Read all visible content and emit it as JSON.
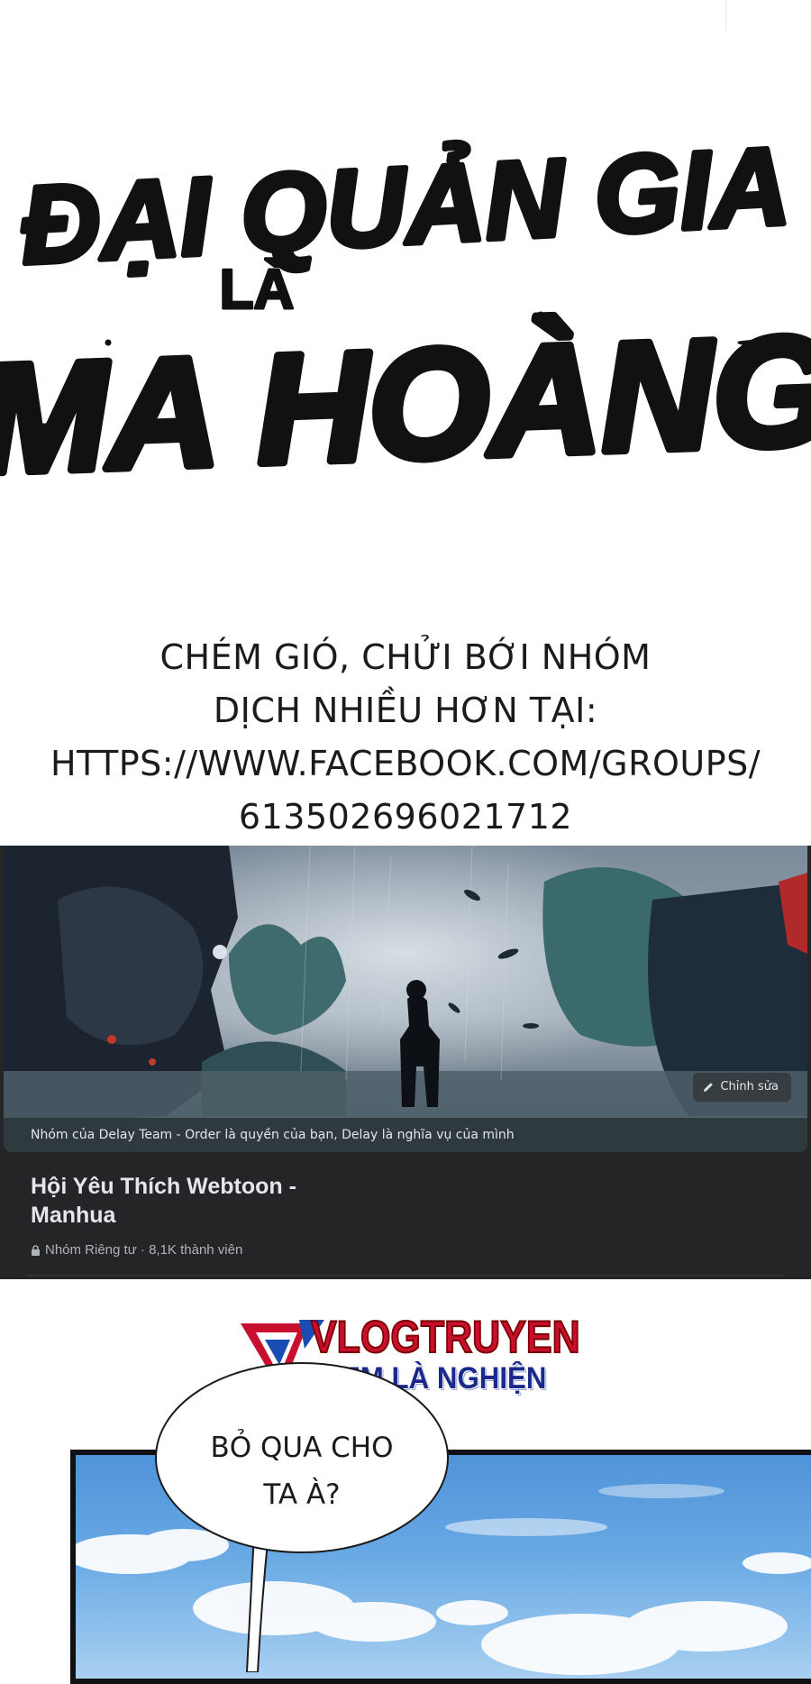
{
  "title_logo": {
    "line1": "ĐẠI QUẢN GIA",
    "line2": "LÀ",
    "line3": "MA HOÀNG"
  },
  "promo": {
    "lines": [
      "CHÉM GIÓ, CHỬI BỚI NHÓM",
      "DỊCH NHIỀU HƠN TẠI:",
      "HTTPS://WWW.FACEBOOK.COM/GROUPS/",
      "613502696021712"
    ]
  },
  "facebook_group": {
    "edit_cover_label": "Chỉnh sửa",
    "cover_caption": "Nhóm của Delay Team - Order là quyền của bạn, Delay là nghĩa vụ của mình",
    "group_name_line1": "Hội Yêu Thích Webtoon -",
    "group_name_line2": "Manhua",
    "meta": "Nhóm Riêng tư · 8,1K thành viên",
    "lock_icon": "lock-icon",
    "edit_icon": "pencil-icon"
  },
  "watermark": {
    "brand": "VLOGTRUYEN",
    "tagline": "XEM LÀ NGHIỆN",
    "colors": {
      "brand": "#c8102e",
      "tagline": "#1a2a8c"
    }
  },
  "speech_bubble": {
    "line1": "BỎ QUA CHO",
    "line2": "TA À?"
  }
}
